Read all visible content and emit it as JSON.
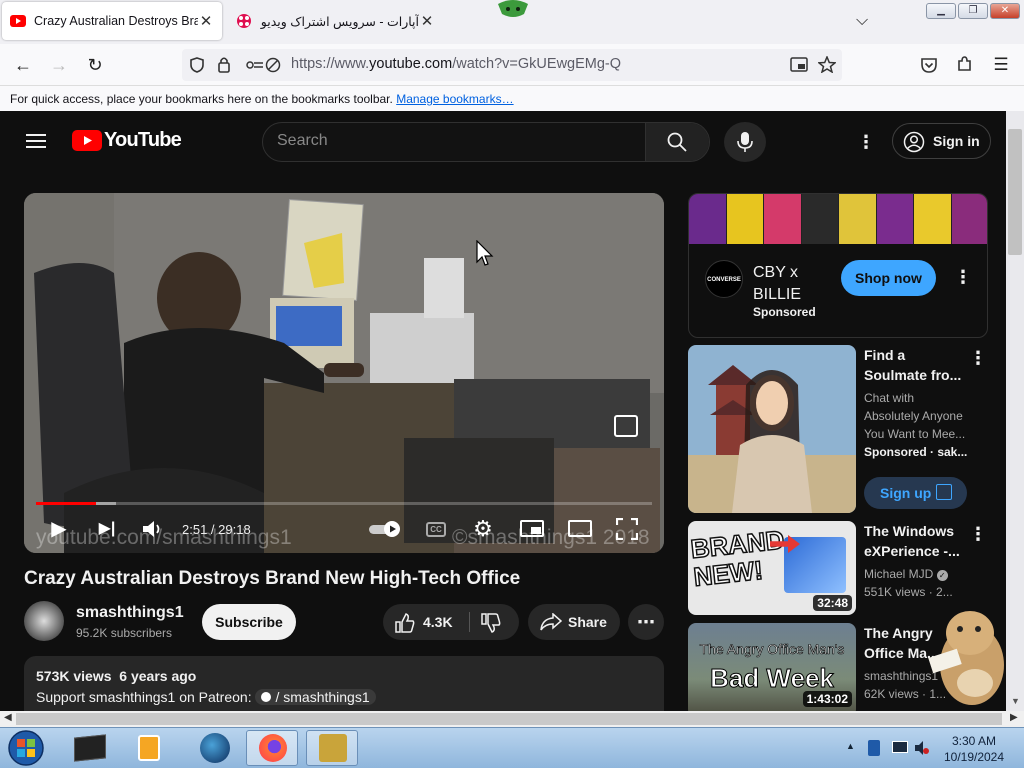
{
  "browser": {
    "tabs": [
      {
        "title": "Crazy Australian Destroys Brand New High-Tech Office",
        "active": true
      },
      {
        "title": "آپارات - سرویس اشتراک ویدیو",
        "active": false
      }
    ],
    "url_prefix": "https://www.",
    "url_host": "youtube.com",
    "url_path": "/watch?v=GkUEwgEMg-Q",
    "bookmarks_text": "For quick access, place your bookmarks here on the bookmarks toolbar.",
    "bookmarks_link": "Manage bookmarks…"
  },
  "youtube": {
    "logo": "YouTube",
    "search_placeholder": "Search",
    "sign_in": "Sign in",
    "player": {
      "time": "2:51 / 29:18",
      "progress_fraction": 0.097,
      "watermark_left": "youtube.com/smashthings1",
      "watermark_right": "©smashthings1 2018"
    },
    "video": {
      "title": "Crazy Australian Destroys Brand New High-Tech Office",
      "channel": "smashthings1",
      "subscribers": "95.2K subscribers",
      "subscribe": "Subscribe",
      "likes": "4.3K",
      "share": "Share",
      "views": "573K views",
      "age": "6 years ago",
      "desc_prefix": "Support smashthings1 on Patreon:",
      "desc_tag": "/ smashthings1"
    },
    "ad": {
      "brand": "CONVERSE",
      "title": "CBY x BILLIE",
      "sponsored": "Sponsored",
      "cta": "Shop now"
    },
    "recommendations": [
      {
        "title": "Find a Soulmate fro...",
        "line1": "Chat with Absolutely Anyone You Want to Mee...",
        "line2": "Sponsored · sak...",
        "cta": "Sign up"
      },
      {
        "title": "The Windows eXPerience -...",
        "line1": "Michael MJD",
        "line2": "551K views · 2...",
        "duration": "32:48",
        "thumb_text": "BRAND NEW!"
      },
      {
        "title": "The Angry Office Ma...",
        "line1": "smashthings1",
        "line2": "62K views · 1...",
        "duration": "1:43:02",
        "thumb_text_top": "The Angry Office Man's",
        "thumb_text_bottom": "Bad Week"
      }
    ]
  },
  "taskbar": {
    "time": "3:30 AM",
    "date": "10/19/2024"
  },
  "colors": {
    "youtube_red": "#ff0000",
    "accent_blue": "#3ea6ff",
    "yt_bg": "#0f0f0f"
  }
}
